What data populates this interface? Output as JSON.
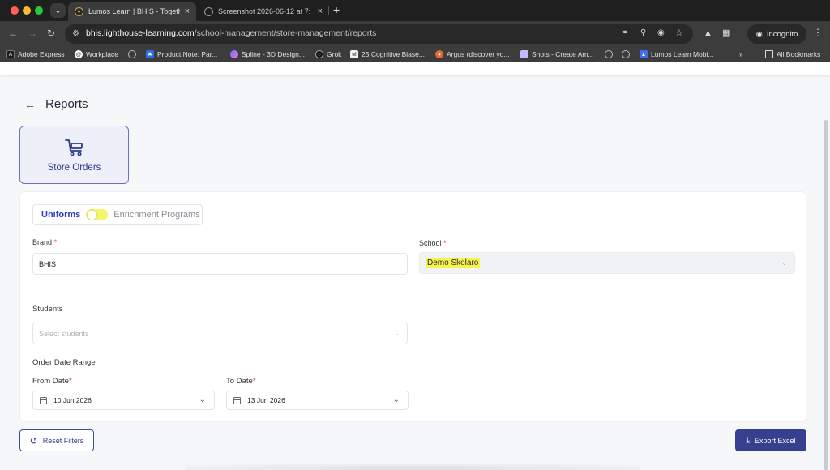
{
  "browser": {
    "tabs": [
      {
        "title": "Lumos Learn | BHIS - Together",
        "active": true
      },
      {
        "title": "Screenshot 2026-06-12 at 7:",
        "active": false
      }
    ],
    "url_host": "bhis.lighthouse-learning.com",
    "url_path": "/school-management/store-management/reports",
    "incognito_label": "Incognito",
    "bookmarks": [
      "Adobe Express",
      "Workplace",
      "Product Note: Par...",
      "Spline - 3D Design...",
      "Grok",
      "25 Cognitive Biase...",
      "Argus (discover yo...",
      "Shots - Create Am...",
      "Lumos Learn Mobi..."
    ],
    "bookmarks_overflow": "»",
    "all_bookmarks": "All Bookmarks"
  },
  "page": {
    "title": "Reports",
    "card_label": "Store Orders",
    "toggle": {
      "left": "Uniforms",
      "right": "Enrichment Programs"
    },
    "brand": {
      "label": "Brand",
      "value": "BHIS"
    },
    "school": {
      "label": "School",
      "value": "Demo Skolaro"
    },
    "students": {
      "label": "Students",
      "placeholder": "Select students"
    },
    "order_date_range": "Order Date Range",
    "from_date": {
      "label": "From Date",
      "value": "10 Jun 2026"
    },
    "to_date": {
      "label": "To Date",
      "value": "13 Jun 2026"
    },
    "reset_label": "Reset Filters",
    "export_label": "Export Excel",
    "required_mark": "*"
  },
  "colors": {
    "primary": "#373f8f",
    "accent_text": "#2b3bbf",
    "toggle_track": "#f3f56a",
    "highlight": "#f7f54a",
    "required": "#d23c3c"
  }
}
